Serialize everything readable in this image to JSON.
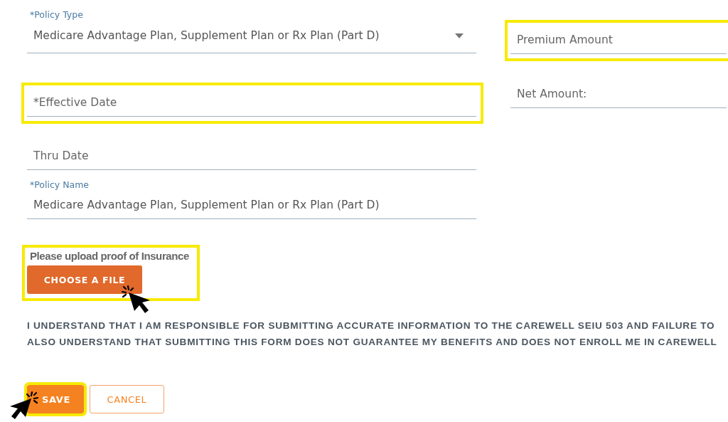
{
  "left_fields": [
    {
      "kind": "select",
      "label": "*Policy Type",
      "value": "Medicare Advantage Plan, Supplement Plan or Rx Plan (Part D)",
      "highlighted": false
    },
    {
      "kind": "text",
      "placeholder": "*Effective Date",
      "highlighted": true
    },
    {
      "kind": "text",
      "placeholder": "Thru Date",
      "highlighted": false
    },
    {
      "kind": "text",
      "label": "*Policy Name",
      "value": "Medicare Advantage Plan, Supplement Plan or Rx Plan (Part D)",
      "highlighted": false
    }
  ],
  "right_fields": [
    {
      "kind": "text",
      "placeholder": "Premium Amount",
      "highlighted": true
    },
    {
      "kind": "text",
      "placeholder": "Net Amount:",
      "highlighted": false
    }
  ],
  "upload": {
    "label": "Please upload proof of Insurance",
    "button": "CHOOSE A FILE",
    "highlighted": true,
    "cursor": true
  },
  "notice": [
    "I UNDERSTAND THAT I AM RESPONSIBLE FOR SUBMITTING ACCURATE INFORMATION TO THE CAREWELL SEIU 503 AND FAILURE TO",
    "ALSO UNDERSTAND THAT SUBMITTING THIS FORM DOES NOT GUARANTEE MY BENEFITS AND DOES NOT ENROLL ME IN CAREWELL"
  ],
  "buttons": [
    {
      "kind": "primary",
      "label": "SAVE",
      "highlighted": true,
      "cursor": true
    },
    {
      "kind": "outline",
      "label": "CANCEL",
      "highlighted": false,
      "cursor": false
    }
  ]
}
